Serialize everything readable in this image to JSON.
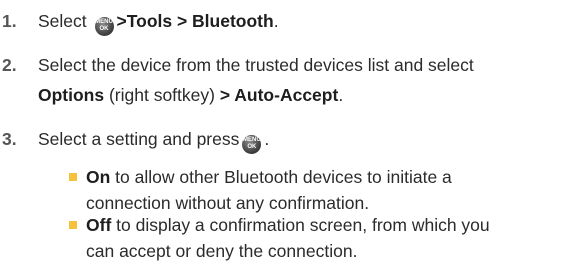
{
  "steps": [
    {
      "num": "1.",
      "select": "Select",
      "path": ">Tools > Bluetooth",
      "end": "."
    },
    {
      "num": "2.",
      "line1": "Select the device from the trusted devices list and select",
      "options": "Options",
      "mid": " (right softkey) ",
      "path": "> Auto-Accept",
      "end": "."
    },
    {
      "num": "3.",
      "text": "Select a setting and press",
      "end": "."
    }
  ],
  "key_label": {
    "top": "MENU",
    "bottom": "OK"
  },
  "sub_items": [
    {
      "term": "On",
      "line1": " to allow other Bluetooth devices to initiate a",
      "line2": "connection without any confirmation."
    },
    {
      "term": "Off",
      "line1": " to display a confirmation screen, from which you",
      "line2": "can accept or deny the connection."
    }
  ],
  "colors": {
    "bullet": "#f6c23e",
    "text": "#2b2b2b"
  },
  "icons": {
    "menu_key": "menu-ok-key-icon"
  }
}
